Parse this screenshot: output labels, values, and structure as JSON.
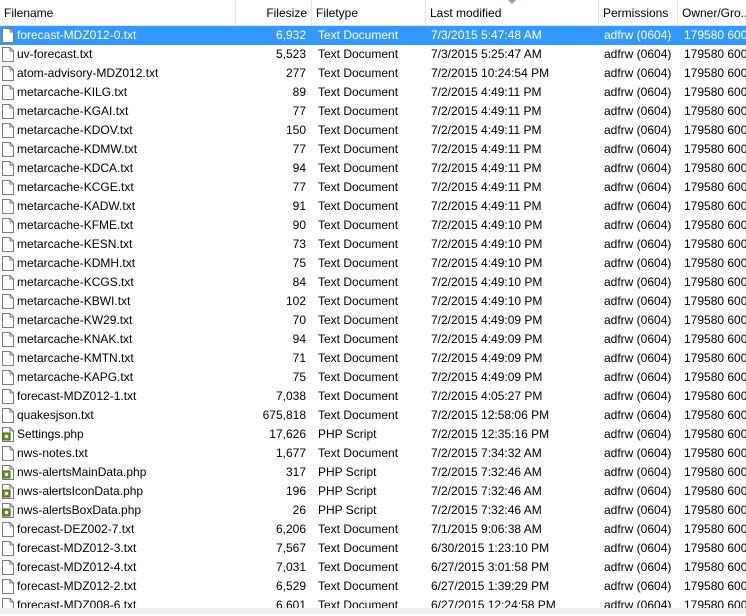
{
  "columns": {
    "filename": "Filename",
    "filesize": "Filesize",
    "filetype": "Filetype",
    "last_modified": "Last modified",
    "permissions": "Permissions",
    "owner_group": "Owner/Gro..."
  },
  "colors": {
    "selection": "#3399ff",
    "header_border": "#e5e5e5"
  },
  "files": [
    {
      "name": "forecast-MDZ012-0.txt",
      "size": "6,932",
      "type": "Text Document",
      "modified": "7/3/2015 5:47:48 AM",
      "perm": "adfrw (0604)",
      "owner": "179580 600",
      "icon": "text-file-icon",
      "selected": true
    },
    {
      "name": "uv-forecast.txt",
      "size": "5,523",
      "type": "Text Document",
      "modified": "7/3/2015 5:25:47 AM",
      "perm": "adfrw (0604)",
      "owner": "179580 600",
      "icon": "text-file-icon"
    },
    {
      "name": "atom-advisory-MDZ012.txt",
      "size": "277",
      "type": "Text Document",
      "modified": "7/2/2015 10:24:54 PM",
      "perm": "adfrw (0604)",
      "owner": "179580 600",
      "icon": "text-file-icon"
    },
    {
      "name": "metarcache-KILG.txt",
      "size": "89",
      "type": "Text Document",
      "modified": "7/2/2015 4:49:11 PM",
      "perm": "adfrw (0604)",
      "owner": "179580 600",
      "icon": "text-file-icon"
    },
    {
      "name": "metarcache-KGAI.txt",
      "size": "77",
      "type": "Text Document",
      "modified": "7/2/2015 4:49:11 PM",
      "perm": "adfrw (0604)",
      "owner": "179580 600",
      "icon": "text-file-icon"
    },
    {
      "name": "metarcache-KDOV.txt",
      "size": "150",
      "type": "Text Document",
      "modified": "7/2/2015 4:49:11 PM",
      "perm": "adfrw (0604)",
      "owner": "179580 600",
      "icon": "text-file-icon"
    },
    {
      "name": "metarcache-KDMW.txt",
      "size": "77",
      "type": "Text Document",
      "modified": "7/2/2015 4:49:11 PM",
      "perm": "adfrw (0604)",
      "owner": "179580 600",
      "icon": "text-file-icon"
    },
    {
      "name": "metarcache-KDCA.txt",
      "size": "94",
      "type": "Text Document",
      "modified": "7/2/2015 4:49:11 PM",
      "perm": "adfrw (0604)",
      "owner": "179580 600",
      "icon": "text-file-icon"
    },
    {
      "name": "metarcache-KCGE.txt",
      "size": "77",
      "type": "Text Document",
      "modified": "7/2/2015 4:49:11 PM",
      "perm": "adfrw (0604)",
      "owner": "179580 600",
      "icon": "text-file-icon"
    },
    {
      "name": "metarcache-KADW.txt",
      "size": "91",
      "type": "Text Document",
      "modified": "7/2/2015 4:49:11 PM",
      "perm": "adfrw (0604)",
      "owner": "179580 600",
      "icon": "text-file-icon"
    },
    {
      "name": "metarcache-KFME.txt",
      "size": "90",
      "type": "Text Document",
      "modified": "7/2/2015 4:49:10 PM",
      "perm": "adfrw (0604)",
      "owner": "179580 600",
      "icon": "text-file-icon"
    },
    {
      "name": "metarcache-KESN.txt",
      "size": "73",
      "type": "Text Document",
      "modified": "7/2/2015 4:49:10 PM",
      "perm": "adfrw (0604)",
      "owner": "179580 600",
      "icon": "text-file-icon"
    },
    {
      "name": "metarcache-KDMH.txt",
      "size": "75",
      "type": "Text Document",
      "modified": "7/2/2015 4:49:10 PM",
      "perm": "adfrw (0604)",
      "owner": "179580 600",
      "icon": "text-file-icon"
    },
    {
      "name": "metarcache-KCGS.txt",
      "size": "84",
      "type": "Text Document",
      "modified": "7/2/2015 4:49:10 PM",
      "perm": "adfrw (0604)",
      "owner": "179580 600",
      "icon": "text-file-icon"
    },
    {
      "name": "metarcache-KBWI.txt",
      "size": "102",
      "type": "Text Document",
      "modified": "7/2/2015 4:49:10 PM",
      "perm": "adfrw (0604)",
      "owner": "179580 600",
      "icon": "text-file-icon"
    },
    {
      "name": "metarcache-KW29.txt",
      "size": "70",
      "type": "Text Document",
      "modified": "7/2/2015 4:49:09 PM",
      "perm": "adfrw (0604)",
      "owner": "179580 600",
      "icon": "text-file-icon"
    },
    {
      "name": "metarcache-KNAK.txt",
      "size": "94",
      "type": "Text Document",
      "modified": "7/2/2015 4:49:09 PM",
      "perm": "adfrw (0604)",
      "owner": "179580 600",
      "icon": "text-file-icon"
    },
    {
      "name": "metarcache-KMTN.txt",
      "size": "71",
      "type": "Text Document",
      "modified": "7/2/2015 4:49:09 PM",
      "perm": "adfrw (0604)",
      "owner": "179580 600",
      "icon": "text-file-icon"
    },
    {
      "name": "metarcache-KAPG.txt",
      "size": "75",
      "type": "Text Document",
      "modified": "7/2/2015 4:49:09 PM",
      "perm": "adfrw (0604)",
      "owner": "179580 600",
      "icon": "text-file-icon"
    },
    {
      "name": "forecast-MDZ012-1.txt",
      "size": "7,038",
      "type": "Text Document",
      "modified": "7/2/2015 4:05:27 PM",
      "perm": "adfrw (0604)",
      "owner": "179580 600",
      "icon": "text-file-icon"
    },
    {
      "name": "quakesjson.txt",
      "size": "675,818",
      "type": "Text Document",
      "modified": "7/2/2015 12:58:06 PM",
      "perm": "adfrw (0604)",
      "owner": "179580 600",
      "icon": "text-file-icon"
    },
    {
      "name": "Settings.php",
      "size": "17,626",
      "type": "PHP Script",
      "modified": "7/2/2015 12:35:16 PM",
      "perm": "adfrw (0604)",
      "owner": "179580 600",
      "icon": "php-script-icon"
    },
    {
      "name": "nws-notes.txt",
      "size": "1,677",
      "type": "Text Document",
      "modified": "7/2/2015 7:34:32 AM",
      "perm": "adfrw (0604)",
      "owner": "179580 600",
      "icon": "text-file-icon"
    },
    {
      "name": "nws-alertsMainData.php",
      "size": "317",
      "type": "PHP Script",
      "modified": "7/2/2015 7:32:46 AM",
      "perm": "adfrw (0604)",
      "owner": "179580 600",
      "icon": "php-script-icon"
    },
    {
      "name": "nws-alertsIconData.php",
      "size": "196",
      "type": "PHP Script",
      "modified": "7/2/2015 7:32:46 AM",
      "perm": "adfrw (0604)",
      "owner": "179580 600",
      "icon": "php-script-icon"
    },
    {
      "name": "nws-alertsBoxData.php",
      "size": "26",
      "type": "PHP Script",
      "modified": "7/2/2015 7:32:46 AM",
      "perm": "adfrw (0604)",
      "owner": "179580 600",
      "icon": "php-script-icon"
    },
    {
      "name": "forecast-DEZ002-7.txt",
      "size": "6,206",
      "type": "Text Document",
      "modified": "7/1/2015 9:06:38 AM",
      "perm": "adfrw (0604)",
      "owner": "179580 600",
      "icon": "text-file-icon"
    },
    {
      "name": "forecast-MDZ012-3.txt",
      "size": "7,567",
      "type": "Text Document",
      "modified": "6/30/2015 1:23:10 PM",
      "perm": "adfrw (0604)",
      "owner": "179580 600",
      "icon": "text-file-icon"
    },
    {
      "name": "forecast-MDZ012-4.txt",
      "size": "7,031",
      "type": "Text Document",
      "modified": "6/27/2015 3:01:58 PM",
      "perm": "adfrw (0604)",
      "owner": "179580 600",
      "icon": "text-file-icon"
    },
    {
      "name": "forecast-MDZ012-2.txt",
      "size": "6,529",
      "type": "Text Document",
      "modified": "6/27/2015 1:39:29 PM",
      "perm": "adfrw (0604)",
      "owner": "179580 600",
      "icon": "text-file-icon"
    },
    {
      "name": "forecast-MDZ008-6.txt",
      "size": "6,601",
      "type": "Text Document",
      "modified": "6/27/2015 12:24:58 PM",
      "perm": "adfrw (0604)",
      "owner": "179580 600",
      "icon": "text-file-icon"
    }
  ]
}
